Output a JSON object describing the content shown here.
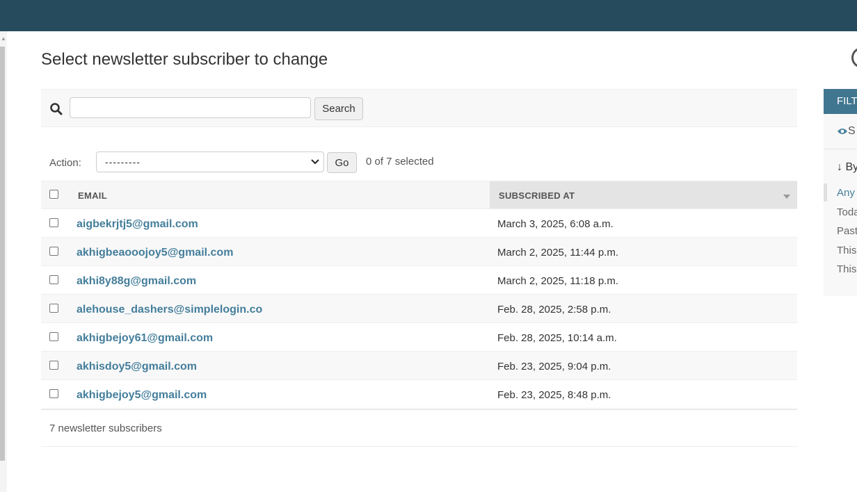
{
  "page_title": "Select newsletter subscriber to change",
  "search": {
    "button_label": "Search",
    "value": ""
  },
  "actions": {
    "label": "Action:",
    "selected": "---------",
    "go_label": "Go",
    "selected_count": "0 of 7 selected"
  },
  "table": {
    "headers": {
      "email": "EMAIL",
      "subscribed_at": "SUBSCRIBED AT"
    },
    "rows": [
      {
        "email": "aigbekrjtj5@gmail.com",
        "subscribed_at": "March 3, 2025, 6:08 a.m."
      },
      {
        "email": "akhigbeaooojoy5@gmail.com",
        "subscribed_at": "March 2, 2025, 11:44 p.m."
      },
      {
        "email": "akhi8y88g@gmail.com",
        "subscribed_at": "March 2, 2025, 11:18 p.m."
      },
      {
        "email": "alehouse_dashers@simplelogin.co",
        "subscribed_at": "Feb. 28, 2025, 2:58 p.m."
      },
      {
        "email": "akhigbejoy61@gmail.com",
        "subscribed_at": "Feb. 28, 2025, 10:14 a.m."
      },
      {
        "email": "akhisdoy5@gmail.com",
        "subscribed_at": "Feb. 23, 2025, 9:04 p.m."
      },
      {
        "email": "akhigbejoy5@gmail.com",
        "subscribed_at": "Feb. 23, 2025, 8:48 p.m."
      }
    ],
    "footer": "7 newsletter subscribers"
  },
  "filter": {
    "title": "FILT",
    "show_label": "S",
    "by_label": "↓ By",
    "items": [
      "Any",
      "Toda",
      "Past",
      "This",
      "This"
    ]
  },
  "colors": {
    "header_bg": "#264b5d",
    "link": "#447e9b",
    "filter_header": "#417690"
  },
  "icons": {
    "search": "search-icon",
    "show": "eye-icon",
    "select": "chevron-down-icon"
  }
}
